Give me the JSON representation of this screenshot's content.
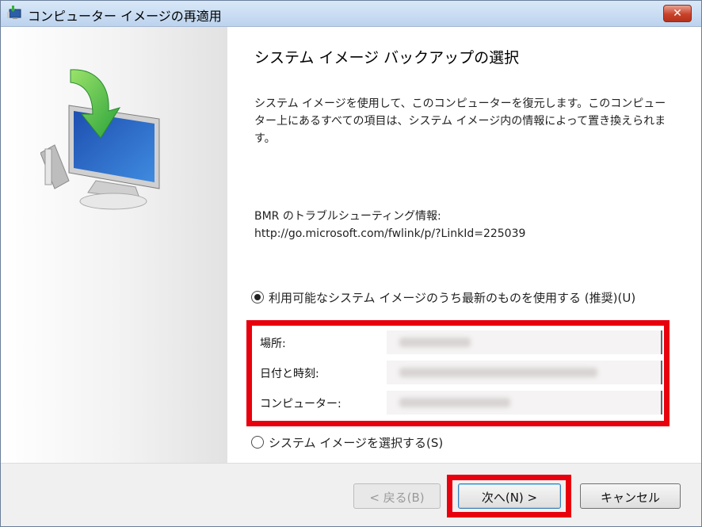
{
  "window": {
    "title": "コンピューター イメージの再適用",
    "close_label": "✕"
  },
  "content": {
    "heading": "システム イメージ バックアップの選択",
    "description": "システム イメージを使用して、このコンピューターを復元します。このコンピューター上にあるすべての項目は、システム イメージ内の情報によって置き換えられます。",
    "bmr_label": "BMR のトラブルシューティング情報:",
    "bmr_link": "http://go.microsoft.com/fwlink/p/?LinkId=225039"
  },
  "options": {
    "latest_label": "利用可能なシステム イメージのうち最新のものを使用する (推奨)(U)",
    "latest_selected": true,
    "select_label": "システム イメージを選択する(S)",
    "select_selected": false
  },
  "info": {
    "location_label": "場所:",
    "datetime_label": "日付と時刻:",
    "computer_label": "コンピューター:"
  },
  "buttons": {
    "back": "< 戻る(B)",
    "next": "次へ(N) >",
    "cancel": "キャンセル"
  },
  "icons": {
    "title": "backup-restore-icon",
    "hero": "monitor-restore-icon",
    "close": "close-icon"
  },
  "colors": {
    "highlight": "#e8000d",
    "title_bar": "#bcd3ee"
  }
}
